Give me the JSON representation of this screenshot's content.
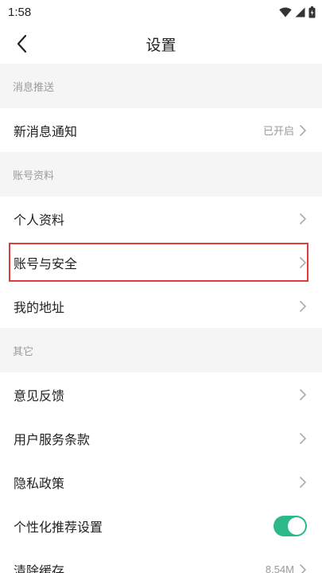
{
  "status": {
    "time": "1:58"
  },
  "header": {
    "title": "设置"
  },
  "sections": {
    "notifications": {
      "title": "消息推送",
      "new_message": {
        "label": "新消息通知",
        "value": "已开启"
      }
    },
    "account": {
      "title": "账号资料",
      "profile": {
        "label": "个人资料"
      },
      "security": {
        "label": "账号与安全"
      },
      "address": {
        "label": "我的地址"
      }
    },
    "other": {
      "title": "其它",
      "feedback": {
        "label": "意见反馈"
      },
      "terms": {
        "label": "用户服务条款"
      },
      "privacy": {
        "label": "隐私政策"
      },
      "personalized": {
        "label": "个性化推荐设置",
        "enabled": true
      },
      "cache": {
        "label": "清除缓存",
        "value": "8.54M"
      }
    }
  },
  "colors": {
    "accent": "#2cb98a",
    "highlight": "#e23a3a"
  }
}
